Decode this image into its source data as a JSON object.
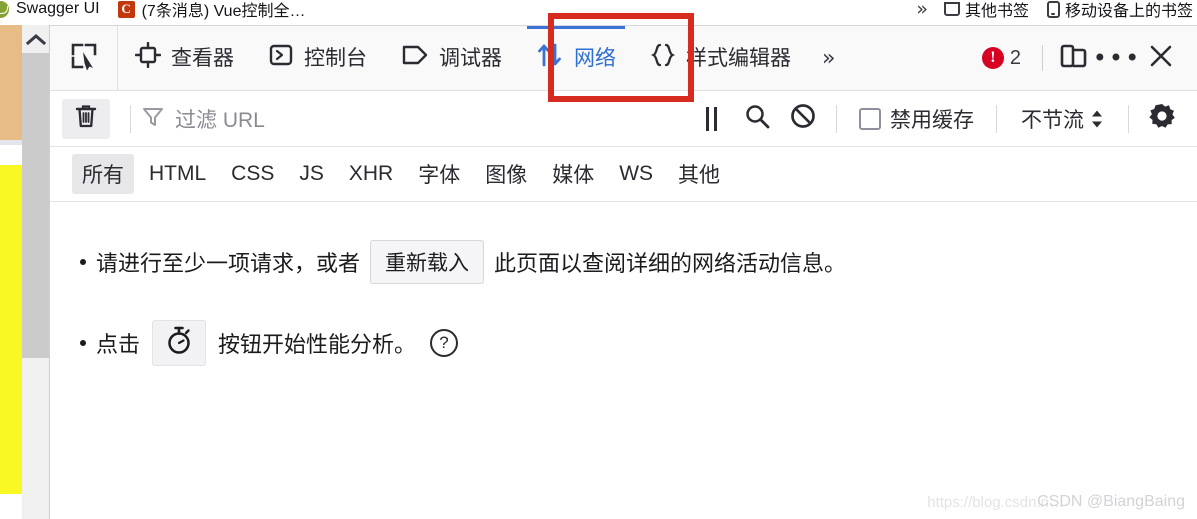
{
  "browser": {
    "bookmarks": [
      {
        "label": "Swagger UI",
        "favicon": "swagger-spider-icon"
      },
      {
        "label": "(7条消息) Vue控制全…",
        "favicon": "csdn-c-icon"
      }
    ],
    "overflow_chevron": "»",
    "right_items": [
      {
        "label": "其他书签",
        "icon": "folder-icon"
      },
      {
        "label": "移动设备上的书签",
        "icon": "phone-icon"
      }
    ]
  },
  "devtools": {
    "picker_icon": "element-picker-icon",
    "tools": [
      {
        "label": "查看器",
        "icon": "inspector-icon",
        "selected": false
      },
      {
        "label": "控制台",
        "icon": "console-icon",
        "selected": false
      },
      {
        "label": "调试器",
        "icon": "debugger-icon",
        "selected": false
      },
      {
        "label": "网络",
        "icon": "network-arrows-icon",
        "selected": true
      },
      {
        "label": "样式编辑器",
        "icon": "style-editor-braces-icon",
        "selected": false
      }
    ],
    "tools_overflow": "»",
    "error_count": "2",
    "error_icon": "error-exclamation-icon",
    "responsive_icon": "responsive-design-mode-icon",
    "meatball_icon": "more-options-icon",
    "close_icon": "close-icon",
    "accent_color": "#3b72d4",
    "selected_tab_text_color": "#2f6fd0",
    "error_color": "#d70022"
  },
  "toolbar": {
    "clear_icon": "trash-icon",
    "filter_icon": "funnel-icon",
    "filter_placeholder": "过滤 URL",
    "pause_icon": "pause-icon",
    "search_icon": "search-icon",
    "block_icon": "block-request-icon",
    "disable_cache_label": "禁用缓存",
    "disable_cache_checked": false,
    "throttle_label": "不节流",
    "throttle_spinner_icon": "updown-spinner-icon",
    "settings_icon": "gear-icon"
  },
  "type_filters": {
    "items": [
      {
        "label": "所有",
        "active": true
      },
      {
        "label": "HTML",
        "active": false
      },
      {
        "label": "CSS",
        "active": false
      },
      {
        "label": "JS",
        "active": false
      },
      {
        "label": "XHR",
        "active": false
      },
      {
        "label": "字体",
        "active": false
      },
      {
        "label": "图像",
        "active": false
      },
      {
        "label": "媒体",
        "active": false
      },
      {
        "label": "WS",
        "active": false
      },
      {
        "label": "其他",
        "active": false
      }
    ]
  },
  "empty_state": {
    "hint1_before": "请进行至少一项请求，或者",
    "hint1_button": "重新载入",
    "hint1_after": "此页面以查阅详细的网络活动信息。",
    "hint2_before": "点击",
    "hint2_icon": "stopwatch-icon",
    "hint2_after": "按钮开始性能分析。",
    "help_glyph": "?"
  },
  "watermarks": {
    "url": "https://blog.csdn.n…",
    "user": "CSDN @BiangBaing"
  },
  "annotation": {
    "shape": "red-rectangle-highlight",
    "color": "#d62b1f",
    "target": "网络"
  },
  "page_behind": {
    "scrollbar_up_icon": "scroll-up-arrow-icon",
    "strip_colors": {
      "orange": "#e8bc87",
      "divider": "#e2e4ee",
      "yellow": "#faf824"
    }
  }
}
